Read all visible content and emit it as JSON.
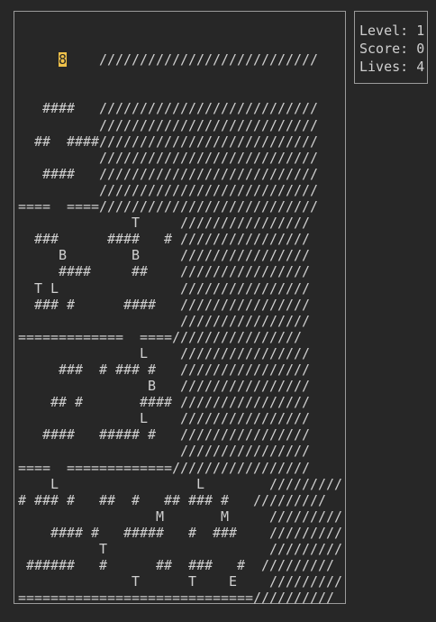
{
  "board": {
    "rows": [
      "     ",
      "   ####   ///////////////////////////",
      "          ///////////////////////////",
      "  ##  ####///////////////////////////",
      "          ///////////////////////////",
      "   ####   ///////////////////////////",
      "          ///////////////////////////",
      "====  ====///////////////////////////",
      "              T     ////////////////",
      "  ###      ####   # ////////////////",
      "     B        B     ////////////////",
      "     ####     ##    ////////////////",
      "  T L               ////////////////",
      "  ### #      ####   ////////////////",
      "                    ////////////////",
      "=============  ====////////////////",
      "               L    ////////////////",
      "     ###  # ### #   ////////////////",
      "                B   ////////////////",
      "    ## #       #### ////////////////",
      "               L    ////////////////",
      "   ####   ##### #   ////////////////",
      "                    ////////////////",
      "====  =============/////////////////",
      "    L                 L        /////////",
      "# ### #   ##  #   ## ### #   /////////",
      "                 M       M     /////////",
      "    #### #   #####   #  ###    /////////",
      "          T                    /////////",
      " ######   #      ##  ###   #  /////////",
      "              T      T    E    /////////",
      "=============================//////////"
    ],
    "player_prefix": "     ",
    "player_glyph": "8",
    "player_suffix": "    ///////////////////////////"
  },
  "status": {
    "level_text": "Level: 1",
    "score_text": "Score: 0",
    "lives_text": "Lives: 4"
  },
  "colors": {
    "background": "#272727",
    "text": "#cfcfcf",
    "border": "#9a9a9a",
    "player_highlight": "#f0c24a"
  }
}
